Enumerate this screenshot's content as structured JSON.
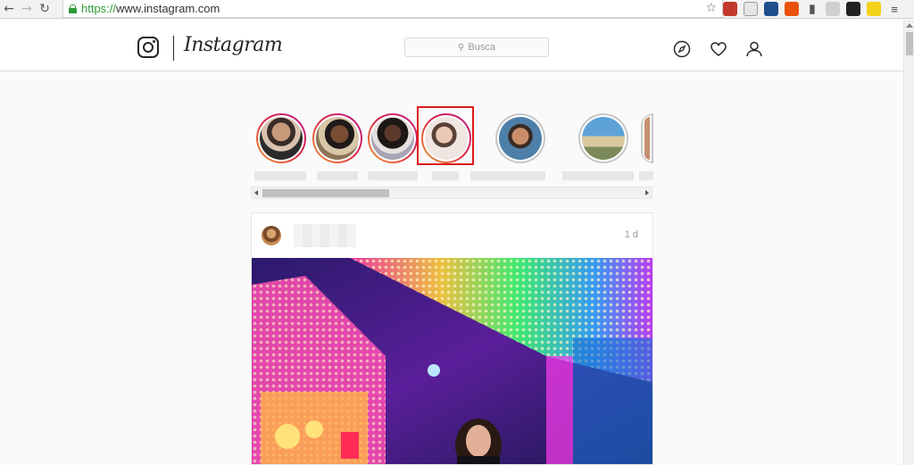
{
  "browser": {
    "url_protocol": "https://",
    "url_rest": "www.instagram.com",
    "back_icon": "back-arrow-icon",
    "forward_icon": "forward-arrow-icon",
    "reload_icon": "reload-icon"
  },
  "header": {
    "wordmark": "Instagram",
    "search_placeholder": "Busca"
  },
  "post": {
    "time": "1 d"
  },
  "colors": {
    "highlight": "#e01b1b",
    "story_ring_start": "#f09433",
    "story_ring_end": "#bc1888",
    "secure": "#2e9b3a"
  }
}
